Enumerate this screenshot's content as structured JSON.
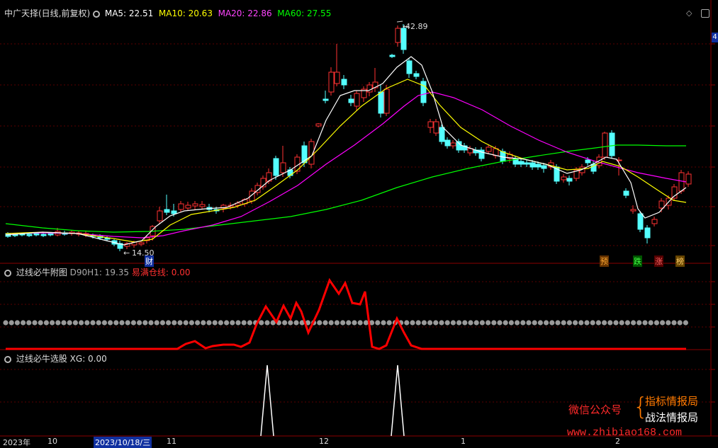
{
  "main": {
    "title": "中广天择(日线,前复权)",
    "ma5": "MA5: 22.51",
    "ma10": "MA10: 20.63",
    "ma20": "MA20: 22.86",
    "ma60": "MA60: 27.55",
    "high_price": "42.89",
    "low_price": "14.50",
    "right_badge": "4",
    "markers": [
      "财",
      "预",
      "跌",
      "涨",
      "榜"
    ]
  },
  "panel2": {
    "name": "过线必牛附图",
    "d90h1": "D90H1: 19.35",
    "cang": "易满仓线: 0.00"
  },
  "panel3": {
    "name": "过线必牛选股",
    "xg": "XG: 0.00"
  },
  "axis": {
    "labels": [
      "2023年",
      "10",
      "2023/10/18/三",
      "11",
      "12",
      "1",
      "2"
    ]
  },
  "watermark": {
    "wechat": "微信公众号",
    "line1": "指标情报局",
    "line2": "战法情报局",
    "url": "www.zhibiao168.com"
  },
  "colors": {
    "up": "#ff3232",
    "down": "#54ffff",
    "ma5": "#ffffff",
    "ma10": "#ffff00",
    "ma20": "#ff00ff",
    "ma60": "#00ff00",
    "signal": "#ff0000"
  }
}
